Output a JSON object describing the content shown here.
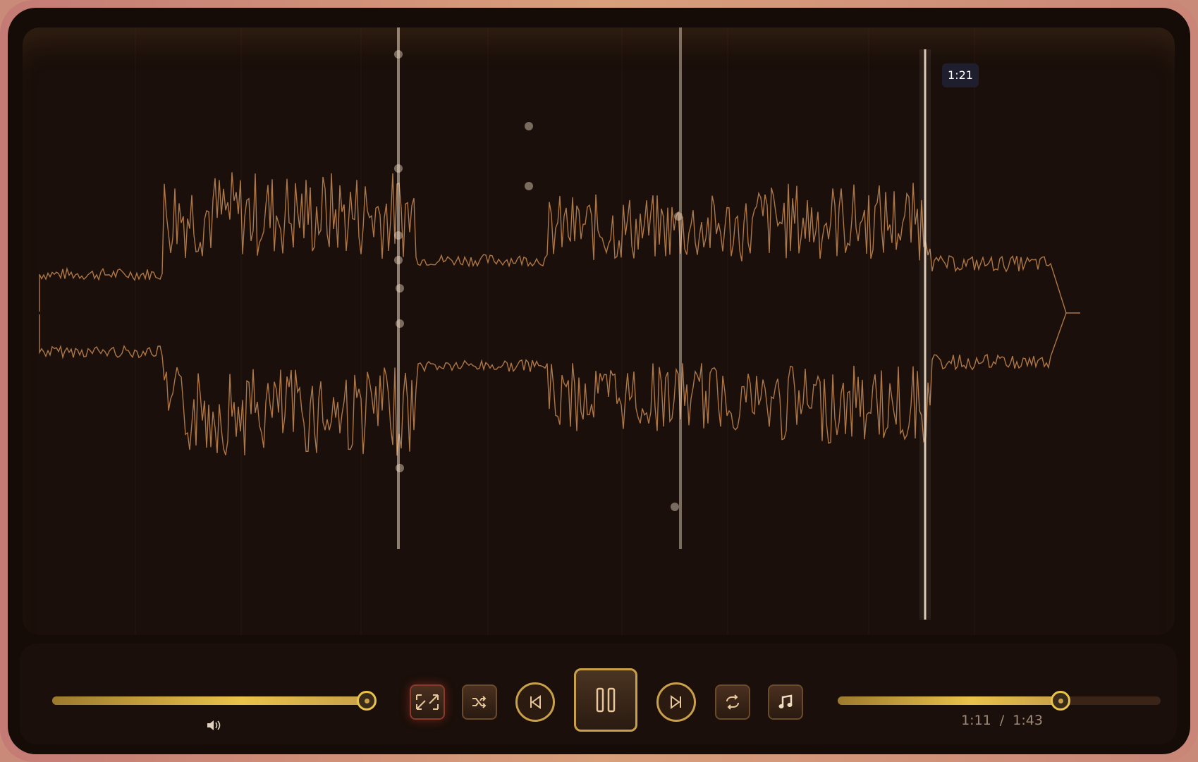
{
  "tooltip": {
    "time": "1:21"
  },
  "volume": {
    "level": 0.97
  },
  "progress": {
    "current": "1:11",
    "separator": "/",
    "total": "1:43",
    "fraction": 0.69
  },
  "icons": {
    "expand": "expand-icon",
    "shuffle": "shuffle-icon",
    "previous": "previous-icon",
    "pause": "pause-icon",
    "next": "next-icon",
    "repeat": "repeat-icon",
    "music": "music-note-icon",
    "volume": "volume-icon"
  },
  "colors": {
    "accent": "#e8c24a",
    "waveform": "#c88a52",
    "background": "#150c08"
  }
}
